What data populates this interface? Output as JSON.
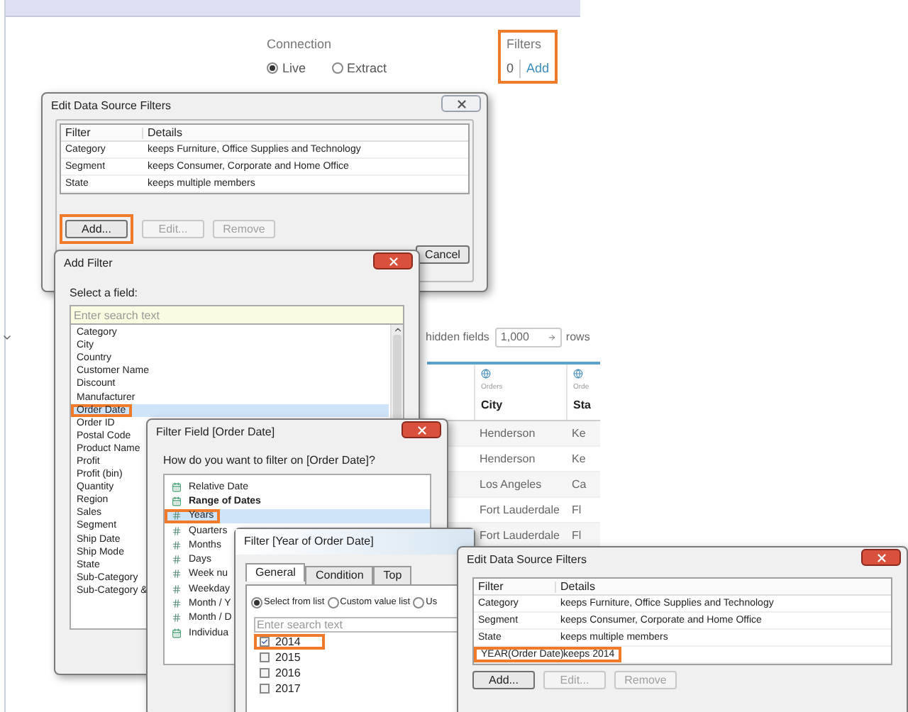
{
  "connection": {
    "label": "Connection",
    "options": [
      {
        "label": "Live",
        "selected": true
      },
      {
        "label": "Extract",
        "selected": false
      }
    ]
  },
  "filters_summary": {
    "label": "Filters",
    "count": "0",
    "action": "Add",
    "highlighted": true
  },
  "data_preview": {
    "hidden_fields_label": "hidden fields",
    "rows_value": "1,000",
    "rows_label": "rows",
    "columns": [
      {
        "source": "Orders",
        "name": "City"
      },
      {
        "source": "Orde",
        "name": "Sta"
      }
    ],
    "rows": [
      [
        "Henderson",
        "Ke"
      ],
      [
        "Henderson",
        "Ke"
      ],
      [
        "Los Angeles",
        "Ca"
      ],
      [
        "Fort Lauderdale",
        "Fl"
      ],
      [
        "Fort Lauderdale",
        "Fl"
      ]
    ]
  },
  "edit_filters_dialog": {
    "title": "Edit Data Source Filters",
    "active": false,
    "columns": [
      "Filter",
      "Details"
    ],
    "rows": [
      {
        "filter": "Category",
        "details": "keeps Furniture, Office Supplies and Technology",
        "highlighted": false
      },
      {
        "filter": "Segment",
        "details": "keeps Consumer, Corporate and Home Office",
        "highlighted": false
      },
      {
        "filter": "State",
        "details": "keeps multiple members",
        "highlighted": false
      }
    ],
    "buttons": [
      {
        "label": "Add...",
        "disabled": false,
        "highlighted": true
      },
      {
        "label": "Edit...",
        "disabled": true,
        "highlighted": false
      },
      {
        "label": "Remove",
        "disabled": true,
        "highlighted": false
      }
    ],
    "cancel": "Cancel"
  },
  "add_filter_dialog": {
    "title": "Add Filter",
    "active": true,
    "prompt": "Select a field:",
    "search_placeholder": "Enter search text",
    "fields": [
      {
        "label": "Category",
        "selected": false,
        "highlighted": false
      },
      {
        "label": "City",
        "selected": false,
        "highlighted": false
      },
      {
        "label": "Country",
        "selected": false,
        "highlighted": false
      },
      {
        "label": "Customer Name",
        "selected": false,
        "highlighted": false
      },
      {
        "label": "Discount",
        "selected": false,
        "highlighted": false
      },
      {
        "label": "Manufacturer",
        "selected": false,
        "highlighted": false
      },
      {
        "label": "Order Date",
        "selected": true,
        "highlighted": true
      },
      {
        "label": "Order ID",
        "selected": false,
        "highlighted": false
      },
      {
        "label": "Postal Code",
        "selected": false,
        "highlighted": false
      },
      {
        "label": "Product Name",
        "selected": false,
        "highlighted": false
      },
      {
        "label": "Profit",
        "selected": false,
        "highlighted": false
      },
      {
        "label": "Profit (bin)",
        "selected": false,
        "highlighted": false
      },
      {
        "label": "Quantity",
        "selected": false,
        "highlighted": false
      },
      {
        "label": "Region",
        "selected": false,
        "highlighted": false
      },
      {
        "label": "Sales",
        "selected": false,
        "highlighted": false
      },
      {
        "label": "Segment",
        "selected": false,
        "highlighted": false
      },
      {
        "label": "Ship Date",
        "selected": false,
        "highlighted": false
      },
      {
        "label": "Ship Mode",
        "selected": false,
        "highlighted": false
      },
      {
        "label": "State",
        "selected": false,
        "highlighted": false
      },
      {
        "label": "Sub-Category",
        "selected": false,
        "highlighted": false
      },
      {
        "label": "Sub-Category &",
        "selected": false,
        "highlighted": false
      }
    ]
  },
  "filter_field_dialog": {
    "title": "Filter Field [Order Date]",
    "active": true,
    "question": "How do you want to filter on [Order Date]?",
    "options": [
      {
        "label": "Relative Date",
        "kind": "date",
        "selected": false,
        "highlighted": false
      },
      {
        "label": "Range of Dates",
        "kind": "range",
        "selected": false,
        "highlighted": false
      },
      {
        "label": "Years",
        "kind": "part",
        "selected": true,
        "highlighted": true
      },
      {
        "label": "Quarters",
        "kind": "part",
        "selected": false,
        "highlighted": false
      },
      {
        "label": "Months",
        "kind": "part",
        "selected": false,
        "highlighted": false
      },
      {
        "label": "Days",
        "kind": "part",
        "selected": false,
        "highlighted": false
      },
      {
        "label": "Week nu",
        "kind": "part",
        "selected": false,
        "highlighted": false
      },
      {
        "label": "Weekday",
        "kind": "part",
        "selected": false,
        "highlighted": false
      },
      {
        "label": "Month / Y",
        "kind": "part",
        "selected": false,
        "highlighted": false
      },
      {
        "label": "Month / D",
        "kind": "part",
        "selected": false,
        "highlighted": false
      },
      {
        "label": "Individua",
        "kind": "date",
        "selected": false,
        "highlighted": false
      }
    ]
  },
  "year_filter_dialog": {
    "title": "Filter [Year of Order Date]",
    "tabs": [
      {
        "label": "General",
        "selected": true
      },
      {
        "label": "Condition",
        "selected": false
      },
      {
        "label": "Top",
        "selected": false
      }
    ],
    "modes": [
      {
        "label": "Select from list",
        "selected": true
      },
      {
        "label": "Custom value list",
        "selected": false
      },
      {
        "label": "Us",
        "selected": false
      }
    ],
    "search_placeholder": "Enter search text",
    "values": [
      {
        "label": "2014",
        "checked": true,
        "highlighted": true
      },
      {
        "label": "2015",
        "checked": false,
        "highlighted": false
      },
      {
        "label": "2016",
        "checked": false,
        "highlighted": false
      },
      {
        "label": "2017",
        "checked": false,
        "highlighted": false
      }
    ]
  },
  "edit_filters_dialog_updated": {
    "title": "Edit Data Source Filters",
    "active": true,
    "columns": [
      "Filter",
      "Details"
    ],
    "rows": [
      {
        "filter": "Category",
        "details": "keeps Furniture, Office Supplies and Technology",
        "highlighted": false
      },
      {
        "filter": "Segment",
        "details": "keeps Consumer, Corporate and Home Office",
        "highlighted": false
      },
      {
        "filter": "State",
        "details": "keeps multiple members",
        "highlighted": false
      },
      {
        "filter": "YEAR(Order Date)",
        "details": "keeps 2014",
        "highlighted": true
      }
    ],
    "buttons": [
      {
        "label": "Add...",
        "disabled": false,
        "highlighted": false
      },
      {
        "label": "Edit...",
        "disabled": true,
        "highlighted": false
      },
      {
        "label": "Remove",
        "disabled": true,
        "highlighted": false
      }
    ]
  }
}
